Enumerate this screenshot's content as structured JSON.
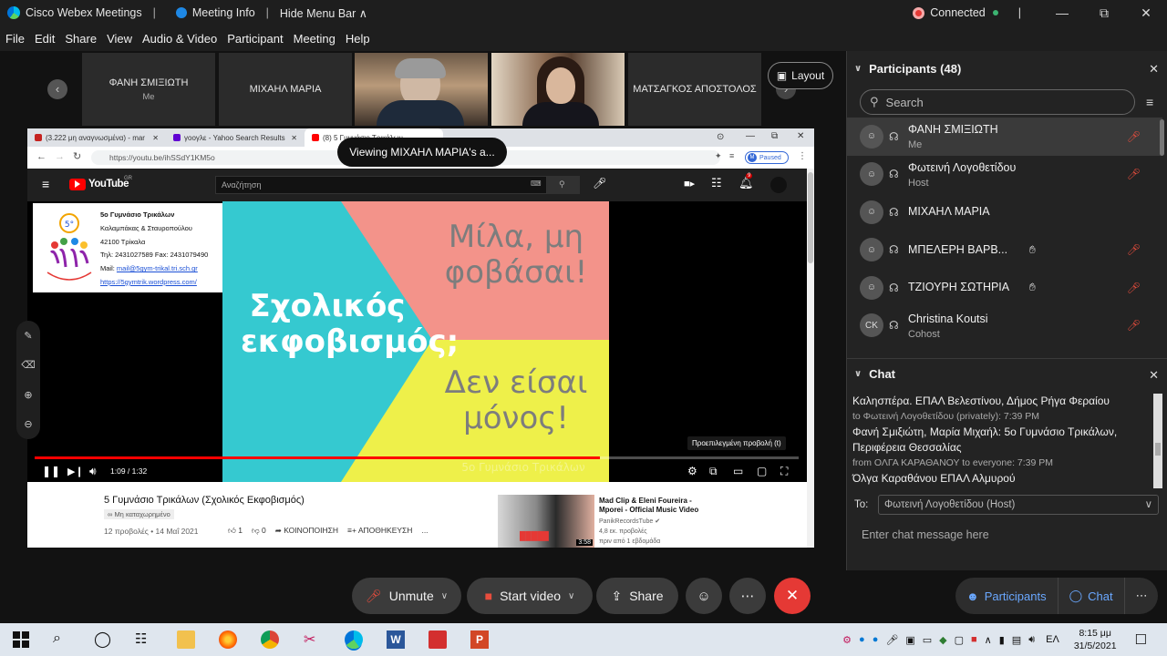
{
  "titlebar": {
    "app_name": "Cisco Webex Meetings",
    "meeting_info": "Meeting Info",
    "hide_menu_bar": "Hide Menu Bar",
    "connection_status": "Connected"
  },
  "menu": [
    "File",
    "Edit",
    "Share",
    "View",
    "Audio & Video",
    "Participant",
    "Meeting",
    "Help"
  ],
  "thumbnails": [
    {
      "name": "ΦΑΝΗ ΣΜΙΞΙΩΤΗ",
      "sub": "Me"
    },
    {
      "name": "ΜΙΧΑΗΛ ΜΑΡΙΑ",
      "sub": ""
    },
    {
      "name": "",
      "sub": ""
    },
    {
      "name": "",
      "sub": ""
    },
    {
      "name": "ΜΑΤΣΑΓΚΟΣ ΑΠΟΣΤΟΛΟΣ",
      "sub": ""
    }
  ],
  "layout_button": "Layout",
  "viewing_badge": "Viewing ΜΙΧΑΗΛ ΜΑΡΙΑ's a...",
  "browser": {
    "tabs": [
      {
        "title": "(3.222 μη αναγνωσμένα) - mar",
        "color": "#c5221f"
      },
      {
        "title": "γοογλε - Yahoo Search Results",
        "color": "#6001d2"
      },
      {
        "title": "(8) 5 Γυμνάσιο Τρικάλων",
        "color": "#ff0000"
      }
    ],
    "url": "https://youtu.be/ihSSdY1KM5o",
    "paused_label": "Paused",
    "profile_initial": "M"
  },
  "youtube": {
    "logo_text": "YouTube",
    "region": "GR",
    "search_placeholder": "Αναζήτηση",
    "notification_count": "9",
    "school_card": {
      "title": "5ο Γυμνάσιο Τρικάλων",
      "line1": "Καλαμπάκας & Σταυροπούλου",
      "line2": "42100 Τρίκαλα",
      "line3": "Τηλ: 2431027589 Fax: 2431079490",
      "mail_label": "Mail: ",
      "mail": "mail@5gym-trikal.tri.sch.gr",
      "web": "https://5gymtrik.wordpress.com/"
    },
    "artwork": {
      "left_text": "Σχολικός εκφοβισμός;",
      "top_right_text": "Μίλα, μη φοβάσαι!",
      "bottom_right_text": "Δεν είσαι μόνος!",
      "watermark": "5ο Γυμνάσιο Τρικάλων"
    },
    "tooltip": "Προεπιλεγμένη προβολή (t)",
    "time": "1:09 / 1:32",
    "progress_fraction": 0.74,
    "video_title": "5 Γυμνάσιο Τρικάλων (Σχολικός Εκφοβισμός)",
    "unlisted": "Μη καταχωρημένο",
    "views_date": "12 προβολές • 14 Μαΐ 2021",
    "likes": "1",
    "dislikes": "0",
    "share_label": "ΚΟΙΝΟΠΟΙΗΣΗ",
    "save_label": "ΑΠΟΘΗΚΕΥΣΗ",
    "more": "...",
    "suggested": {
      "title_line1": "Mad Clip & Eleni Foureira -",
      "title_line2": "Mporei - Official Music Video",
      "channel": "PanikRecordsTube",
      "views": "4,8 εκ. προβολές",
      "age": "πριν από 1 εβδομάδα",
      "duration": "3:58"
    }
  },
  "participants": {
    "header": "Participants (48)",
    "search_placeholder": "Search",
    "list": [
      {
        "initials": "",
        "name": "ΦΑΝΗ ΣΜΙΞΙΩΤΗ",
        "role": "Me",
        "muted": true,
        "hand": false,
        "me": true
      },
      {
        "initials": "",
        "name": "Φωτεινή Λογοθετίδου",
        "role": "Host",
        "muted": true,
        "hand": false,
        "me": false
      },
      {
        "initials": "",
        "name": "ΜΙΧΑΗΛ ΜΑΡΙΑ",
        "role": "",
        "muted": false,
        "hand": false,
        "me": false
      },
      {
        "initials": "",
        "name": "ΜΠΕΛΕΡΗ ΒΑΡΒ...",
        "role": "",
        "muted": true,
        "hand": true,
        "me": false
      },
      {
        "initials": "",
        "name": "ΤΖΙΟΥΡΗ ΣΩΤΗΡΙΑ",
        "role": "",
        "muted": true,
        "hand": true,
        "me": false
      },
      {
        "initials": "CK",
        "name": "Christina Koutsi",
        "role": "Cohost",
        "muted": true,
        "hand": false,
        "me": false
      }
    ]
  },
  "chat": {
    "header": "Chat",
    "messages": [
      {
        "type": "msg",
        "text": "Καλησπέρα. ΕΠΑΛ Βελεστίνου, Δήμος Ρήγα Φεραίου"
      },
      {
        "type": "meta",
        "text": "to Φωτεινή Λογοθετίδου (privately):    7:39 PM"
      },
      {
        "type": "msg",
        "text": "Φανή Σμιξιώτη, Μαρία Μιχαήλ: 5ο Γυμνάσιο Τρικάλων, Περιφέρεια Θεσσαλίας"
      },
      {
        "type": "meta",
        "text": "from ΟΛΓΑ ΚΑΡΑΘΑΝΟΥ to everyone:    7:39 PM"
      },
      {
        "type": "msg",
        "text": "Όλγα Καραθάνου ΕΠΑΛ Αλμυρού"
      }
    ],
    "to_label": "To:",
    "to_value": "Φωτεινή Λογοθετίδου (Host)",
    "input_placeholder": "Enter chat message here"
  },
  "controls": {
    "unmute": "Unmute",
    "start_video": "Start video",
    "share": "Share",
    "participants": "Participants",
    "chat": "Chat"
  },
  "taskbar": {
    "language": "ΕΛ",
    "time": "8:15 μμ",
    "date": "31/5/2021"
  },
  "colors": {
    "muted_red": "#e84d3d",
    "end_red": "#e53935",
    "accent_blue": "#6aa8ff"
  }
}
